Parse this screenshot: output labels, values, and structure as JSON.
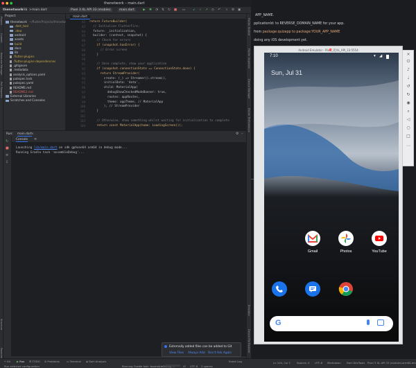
{
  "ide": {
    "project_name": "thenetwork",
    "breadcrumb_sep": ">",
    "lib_crumb": "lib",
    "file_crumb": "main.dart",
    "window_title": "thenetwork – main.dart",
    "device_selector": "Pixel 3 XL API 33 (mobile)",
    "run_config": "main.dart",
    "project_label": "Project",
    "tree": [
      {
        "label": "thenetwork",
        "extra": "~/flutterProjects/thenetwork",
        "kind": "folder",
        "indent": 0,
        "color": ""
      },
      {
        "label": ".dart_tool",
        "kind": "folder",
        "indent": 1,
        "color": "yellow"
      },
      {
        "label": ".idea",
        "kind": "folder",
        "indent": 1,
        "color": "yellow"
      },
      {
        "label": "android",
        "kind": "folder",
        "indent": 1,
        "color": ""
      },
      {
        "label": "assets",
        "kind": "folder",
        "indent": 1,
        "color": ""
      },
      {
        "label": "build",
        "kind": "folder",
        "indent": 1,
        "color": "yellow"
      },
      {
        "label": "docs",
        "kind": "folder",
        "indent": 1,
        "color": ""
      },
      {
        "label": "lib",
        "kind": "folder",
        "indent": 1,
        "color": ""
      },
      {
        "label": ".flutter-plugins",
        "kind": "file",
        "indent": 1,
        "color": "yellow"
      },
      {
        "label": ".flutter-plugins-dependencies",
        "kind": "file",
        "indent": 1,
        "color": "yellow"
      },
      {
        "label": ".gitignore",
        "kind": "file",
        "indent": 1,
        "color": ""
      },
      {
        "label": ".metadata",
        "kind": "file",
        "indent": 1,
        "color": ""
      },
      {
        "label": "analysis_options.yaml",
        "kind": "file",
        "indent": 1,
        "color": ""
      },
      {
        "label": "pubspec.lock",
        "kind": "file",
        "indent": 1,
        "color": ""
      },
      {
        "label": "pubspec.yaml",
        "kind": "file",
        "indent": 1,
        "color": ""
      },
      {
        "label": "README.md",
        "kind": "file",
        "indent": 1,
        "color": ""
      },
      {
        "label": "README2.md",
        "kind": "file",
        "indent": 1,
        "color": "red"
      },
      {
        "label": "External Libraries",
        "kind": "folder",
        "indent": 0,
        "color": ""
      },
      {
        "label": "Scratches and Consoles",
        "kind": "folder",
        "indent": 0,
        "color": ""
      }
    ],
    "editor_tab": "main.dart",
    "code_lines": [
      "return FutureBuilder(",
      "  // Initialize FlutterFire:",
      "  future: _initialization,",
      "  builder: (context, snapshot) {",
      "    // Check for errors",
      "    if (snapshot.hasError) {",
      "      // Error screen",
      "    }",
      "",
      "    // Once complete, show your application",
      "    if (snapshot.connectionState == ConnectionState.done) {",
      "      return StreamProvider(",
      "        create: (_) => Streamer().stream(),",
      "        initialData: 'data',",
      "        child: MaterialApp(",
      "          debugShowCheckedModeBanner: true,",
      "          routes: appRoutes,",
      "          theme: appTheme, // MaterialApp",
      "        ), // StreamProvider",
      "    }",
      "",
      "    // Otherwise, show something whilst waiting for initialization to complete",
      "    return const MaterialApp(home: LoadingScreen());"
    ],
    "run_label": "Run:",
    "run_tab": "main.dart",
    "console_tab": "Console",
    "console_lines": [
      {
        "pre": "Launching ",
        "link": "lib/main.dart",
        "post": " on sdk gphone64 arm64 in debug mode..."
      },
      {
        "pre": "Running Gradle task 'assembleDebug'...",
        "link": "",
        "post": ""
      }
    ],
    "notification": {
      "text": "Externally added files can be added to Git",
      "actions": [
        "View Files",
        "Always Add",
        "Don't Ask Again"
      ]
    },
    "bottom_tabs": [
      "Git",
      "Run",
      "TODO",
      "Problems",
      "Terminal",
      "Dart Analysis"
    ],
    "event_log": "Event Log",
    "status_left": "Run selected configuration",
    "status_task": "Running Gradle task 'assembleDebug'...",
    "status_right": [
      "LF",
      "UTF-8",
      "2 spaces",
      "Ln 104, Col 1",
      "Spaces: 4",
      "UTF-8",
      "Markdown",
      "Dart DevTools",
      "Pixel 3 XL API 33 (android-arm64-emulator)"
    ]
  },
  "doc": {
    "lines": [
      {
        "text": "APP_NAME.",
        "code": ""
      },
      {
        "text": "pplicationId: to REVERSE_DOMAIN_NAME for your app.",
        "code": ""
      },
      {
        "text": " from ",
        "code": "package:quizapp to package:YOUR_APP_NAME"
      },
      {
        "text": "doing any iOS development yet.",
        "code": ""
      }
    ]
  },
  "emulator": {
    "title": "Android Emulator - Pixel_3_XL_API_33:5554",
    "time": "7:10",
    "date": "Sun, Jul 31",
    "apps_row1": [
      {
        "label": "Gmail",
        "icon": "gmail-icon"
      },
      {
        "label": "Photos",
        "icon": "photos-icon"
      },
      {
        "label": "YouTube",
        "icon": "youtube-icon"
      }
    ],
    "dock": [
      {
        "icon": "phone-icon"
      },
      {
        "icon": "messages-icon"
      },
      {
        "icon": "chrome-icon"
      }
    ]
  }
}
